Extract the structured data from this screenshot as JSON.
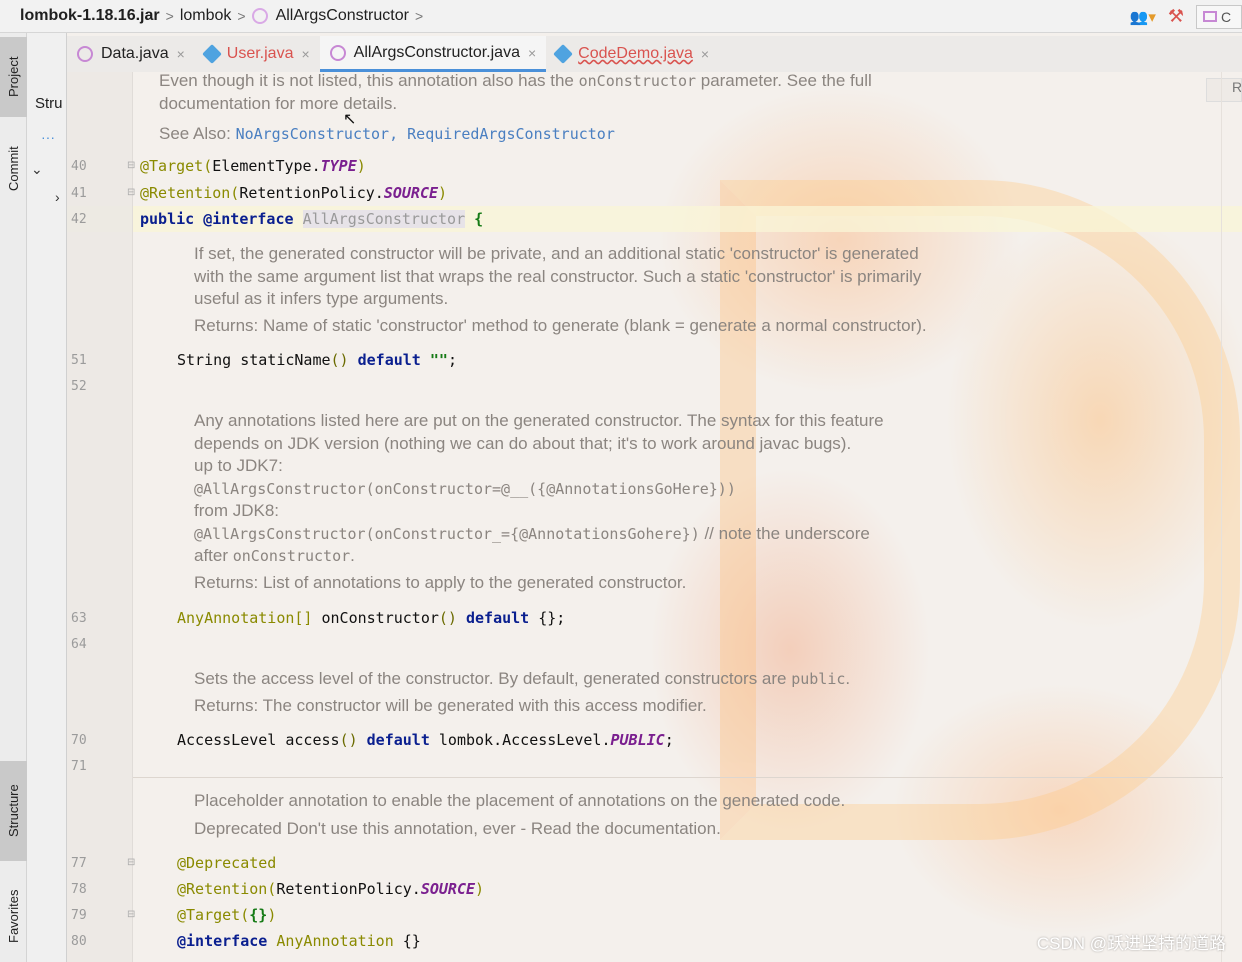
{
  "breadcrumb": {
    "jar": "lombok-1.18.16.jar",
    "package": "lombok",
    "class": "AllArgsConstructor",
    "sep": ">"
  },
  "toolstrip": {
    "project": "Project",
    "commit": "Commit",
    "structure": "Structure",
    "favorites": "Favorites"
  },
  "panel": {
    "header": "Stru",
    "dots": "···"
  },
  "tabs": [
    {
      "label": "Data.java",
      "close": "×"
    },
    {
      "label": "User.java",
      "close": "×"
    },
    {
      "label": "AllArgsConstructor.java",
      "close": "×"
    },
    {
      "label": "CodeDemo.java",
      "close": "×"
    }
  ],
  "reader_mode": "R",
  "run_config": "C",
  "editor": {
    "doc1_line1_a": "Even though it is not listed, this annotation also has the ",
    "doc1_line1_code": "onConstructor",
    "doc1_line1_b": " parameter. See the full",
    "doc1_line2": "documentation for more details.",
    "see_also_label": "See Also: ",
    "see_also_1": "NoArgsConstructor",
    "see_also_sep": ", ",
    "see_also_2": "RequiredArgsConstructor",
    "lines": {
      "l40": "40",
      "l41": "41",
      "l42": "42",
      "l51": "51",
      "l52": "52",
      "l63": "63",
      "l64": "64",
      "l70": "70",
      "l71": "71",
      "l77": "77",
      "l78": "78",
      "l79": "79",
      "l80": "80"
    },
    "c40_a": "@Target(",
    "c40_b": "ElementType.",
    "c40_c": "TYPE",
    "c40_d": ")",
    "c41_a": "@Retention(",
    "c41_b": "RetentionPolicy.",
    "c41_c": "SOURCE",
    "c41_d": ")",
    "c42_kw": "public @interface ",
    "c42_name": "AllArgsConstructor",
    "c42_brace": " {",
    "doc2_1": "If set, the generated constructor will be private, and an additional static 'constructor' is generated",
    "doc2_2": "with the same argument list that wraps the real constructor. Such a static 'constructor' is primarily",
    "doc2_3": "useful as it infers type arguments.",
    "doc2_ret": "Returns: Name of static 'constructor' method to generate (blank = generate a normal constructor).",
    "c51_a": "String staticName",
    "c51_b": "() ",
    "c51_kw": "default ",
    "c51_str": "\"\"",
    "c51_end": ";",
    "doc3_1": "Any annotations listed here are put on the generated constructor. The syntax for this feature",
    "doc3_2": "depends on JDK version (nothing we can do about that; it's to work around javac bugs).",
    "doc3_3": "up to JDK7:",
    "doc3_4": "@AllArgsConstructor(onConstructor=@__({@AnnotationsGoHere}))",
    "doc3_5": "from JDK8:",
    "doc3_6a": "@AllArgsConstructor(onConstructor_={@AnnotationsGohere})",
    "doc3_6b": " // note the underscore",
    "doc3_7a": "after ",
    "doc3_7b": "onConstructor",
    "doc3_7c": ".",
    "doc3_ret": "Returns: List of annotations to apply to the generated constructor.",
    "c63_a": "AnyAnnotation[] ",
    "c63_b": "onConstructor",
    "c63_c": "() ",
    "c63_kw": "default ",
    "c63_d": "{};",
    "doc4_1a": "Sets the access level of the constructor. By default, generated constructors are ",
    "doc4_1b": "public",
    "doc4_1c": ".",
    "doc4_ret": "Returns: The constructor will be generated with this access modifier.",
    "c70_a": "AccessLevel access",
    "c70_b": "() ",
    "c70_kw": "default ",
    "c70_c": "lombok.AccessLevel.",
    "c70_d": "PUBLIC",
    "c70_e": ";",
    "doc5_1": "Placeholder annotation to enable the placement of annotations on the generated code.",
    "doc5_2": "Deprecated Don't use this annotation, ever - Read the documentation.",
    "c77": "@Deprecated",
    "c78_a": "@Retention(",
    "c78_b": "RetentionPolicy.",
    "c78_c": "SOURCE",
    "c78_d": ")",
    "c79_a": "@Target(",
    "c79_b": "{}",
    "c79_c": ")",
    "c80_kw": "@interface ",
    "c80_name": "AnyAnnotation ",
    "c80_brace": "{}"
  },
  "watermark": "CSDN @跃进坚持的道路"
}
